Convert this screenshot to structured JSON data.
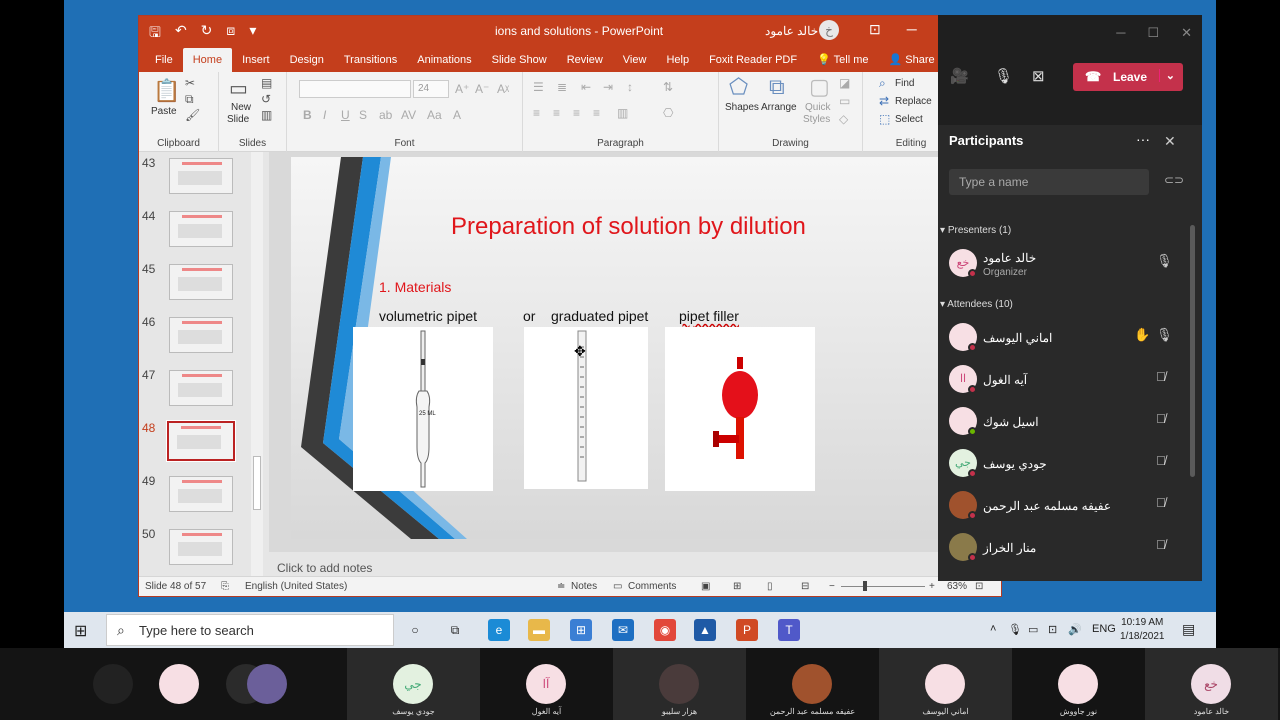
{
  "ppt": {
    "doc_title": "ions and solutions  -  PowerPoint",
    "user": "خالد عامود",
    "user_initial": "خ",
    "tabs": [
      "File",
      "Home",
      "Insert",
      "Design",
      "Transitions",
      "Animations",
      "Slide Show",
      "Review",
      "View",
      "Help",
      "Foxit Reader PDF",
      "Tell me",
      "Share"
    ],
    "ribbon": {
      "paste": "Paste",
      "clipboard": "Clipboard",
      "new_slide": "New",
      "new_slide2": "Slide",
      "slides": "Slides",
      "font_size": "24",
      "font": "Font",
      "paragraph": "Paragraph",
      "shapes": "Shapes",
      "arrange": "Arrange",
      "quick_styles": "Quick",
      "quick_styles2": "Styles",
      "drawing": "Drawing",
      "find": "Find",
      "replace": "Replace",
      "select": "Select",
      "editing": "Editing"
    },
    "thumbnails": [
      {
        "num": "43"
      },
      {
        "num": "44"
      },
      {
        "num": "45"
      },
      {
        "num": "46"
      },
      {
        "num": "47"
      },
      {
        "num": "48"
      },
      {
        "num": "49"
      },
      {
        "num": "50"
      }
    ],
    "selected_slide": "48",
    "slide": {
      "title": "Preparation of  solution by dilution",
      "subtitle": "1. Materials",
      "label_volumetric": "volumetric pipet",
      "label_or": "or",
      "label_graduated": "graduated pipet",
      "label_filler": "pipet filler",
      "pipet_text": "25 ML"
    },
    "notes_placeholder": "Click to add notes",
    "status": {
      "slide_count": "Slide 48 of 57",
      "language": "English (United States)",
      "notes": "Notes",
      "comments": "Comments",
      "zoom": "63%"
    }
  },
  "teams": {
    "leave": "Leave",
    "participants_title": "Participants",
    "search_placeholder": "Type a name",
    "presenters_header": "Presenters (1)",
    "attendees_header": "Attendees (10)",
    "presenter": {
      "name": "خالد عامود",
      "role": "Organizer",
      "initials": "خع"
    },
    "attendees": [
      {
        "name": "اماني اليوسف",
        "initials": "",
        "hand": true
      },
      {
        "name": "آيه الغول",
        "initials": "اا",
        "hand": false
      },
      {
        "name": "اسيل شوك",
        "initials": "",
        "hand": false
      },
      {
        "name": "جودي يوسف",
        "initials": "جي",
        "hand": false
      },
      {
        "name": "عفيفه مسلمه عبد الرحمن",
        "initials": "",
        "hand": false
      },
      {
        "name": "منار الخراز",
        "initials": "",
        "hand": false
      }
    ]
  },
  "taskbar": {
    "search_placeholder": "Type here to search",
    "lang": "ENG",
    "time": "10:19 AM",
    "date": "1/18/2021"
  },
  "strip": [
    {
      "name": "",
      "initials": ""
    },
    {
      "name": "",
      "initials": ""
    },
    {
      "name": "",
      "initials": ""
    },
    {
      "name": "جودي يوسف",
      "initials": "جي"
    },
    {
      "name": "آيه الغول",
      "initials": "آا"
    },
    {
      "name": "هزار سليبو",
      "initials": ""
    },
    {
      "name": "عفيفه مسلمه عبد الرحمن",
      "initials": ""
    },
    {
      "name": "اماني اليوسف",
      "initials": ""
    },
    {
      "name": "نور جاووش",
      "initials": ""
    },
    {
      "name": "خالد عامود",
      "initials": "خع"
    }
  ]
}
